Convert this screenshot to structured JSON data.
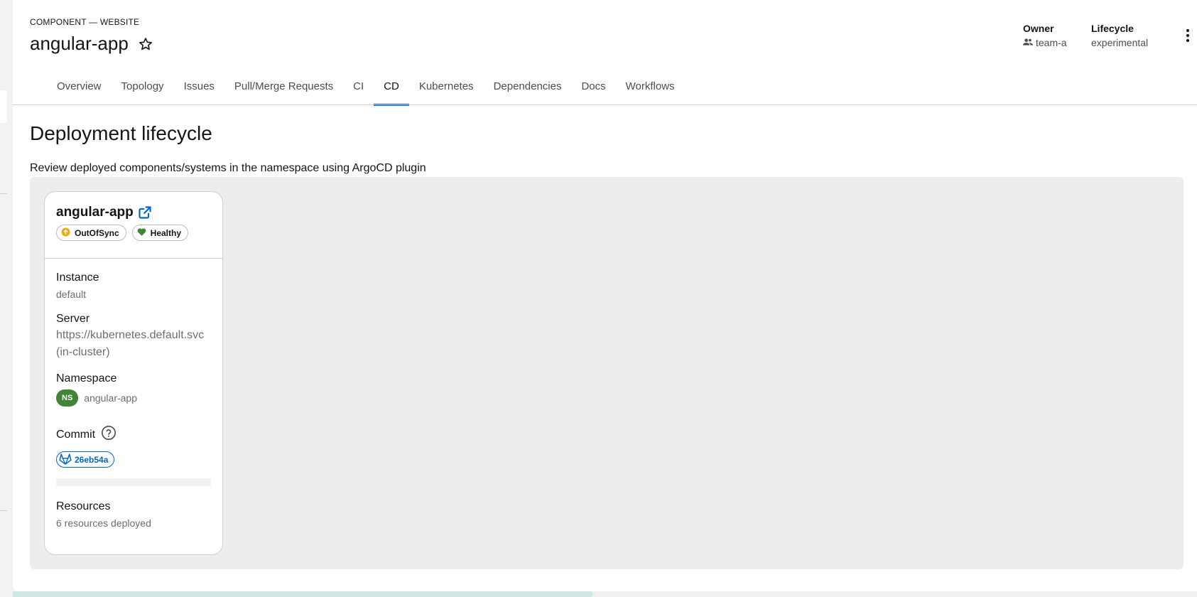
{
  "header": {
    "kind": "COMPONENT — WEBSITE",
    "title": "angular-app",
    "owner_label": "Owner",
    "owner_value": "team-a",
    "lifecycle_label": "Lifecycle",
    "lifecycle_value": "experimental"
  },
  "tabs": [
    {
      "label": "Overview"
    },
    {
      "label": "Topology"
    },
    {
      "label": "Issues"
    },
    {
      "label": "Pull/Merge Requests"
    },
    {
      "label": "CI"
    },
    {
      "label": "CD",
      "active": true
    },
    {
      "label": "Kubernetes"
    },
    {
      "label": "Dependencies"
    },
    {
      "label": "Docs"
    },
    {
      "label": "Workflows"
    }
  ],
  "main": {
    "heading": "Deployment lifecycle",
    "description": "Review deployed components/systems in the namespace using ArgoCD plugin"
  },
  "card": {
    "app_name": "angular-app",
    "sync_status": "OutOfSync",
    "health_status": "Healthy",
    "instance_label": "Instance",
    "instance_value": "default",
    "server_label": "Server",
    "server_value": "https://kubernetes.default.svc (in-cluster)",
    "namespace_label": "Namespace",
    "namespace_badge": "NS",
    "namespace_value": "angular-app",
    "commit_label": "Commit",
    "commit_sha": "26eb54a",
    "resources_label": "Resources",
    "resources_value": "6 resources deployed"
  },
  "colors": {
    "accent": "#0066cc",
    "healthy": "#3e8635",
    "out_of_sync": "#f0ab00",
    "panel_bg": "#ededed"
  },
  "icons": {
    "star": "star-outline-icon",
    "owner": "users-icon",
    "kebab": "kebab-menu-icon",
    "external": "external-link-icon",
    "sync": "arrow-up-circle-icon",
    "health": "heart-icon",
    "help": "question-circle-icon",
    "git": "gitlab-icon"
  }
}
